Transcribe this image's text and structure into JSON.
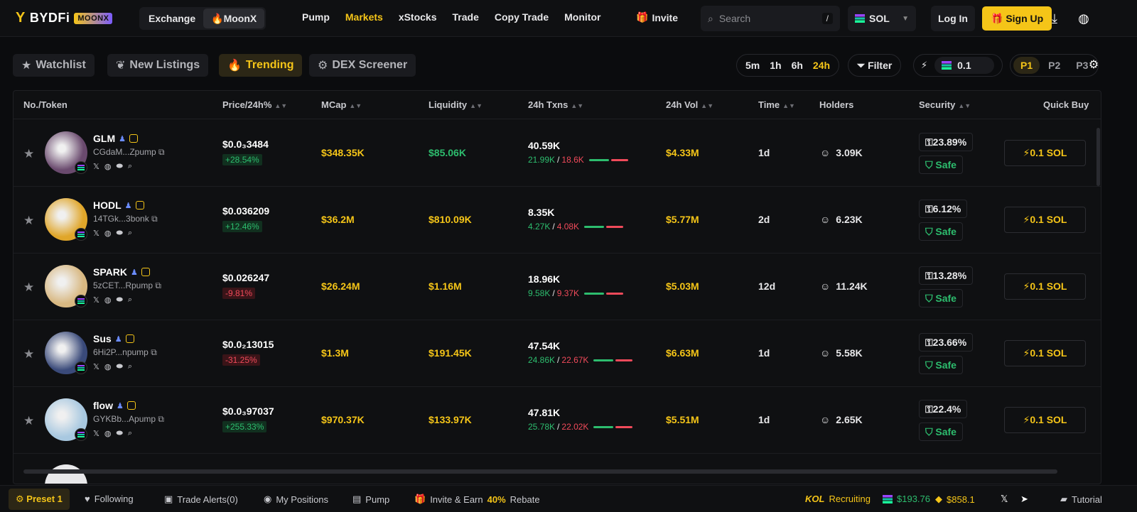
{
  "brand": {
    "name": "BYDFi",
    "badge": "MOONX"
  },
  "header": {
    "segment": [
      "Exchange",
      "MoonX"
    ],
    "links": [
      "Pump",
      "Markets",
      "xStocks",
      "Trade",
      "Copy Trade",
      "Monitor"
    ],
    "active_link": "Markets",
    "invite": "Invite",
    "search_placeholder": "Search",
    "search_shortcut": "/",
    "chain": "SOL",
    "login": "Log In",
    "signup": "Sign Up"
  },
  "tabs": [
    "Watchlist",
    "New Listings",
    "Trending",
    "DEX Screener"
  ],
  "active_tab": "Trending",
  "timeframes": [
    "5m",
    "1h",
    "6h",
    "24h"
  ],
  "active_timeframe": "24h",
  "filter_label": "Filter",
  "quick_amount": "0.1",
  "presets": [
    "P1",
    "P2",
    "P3"
  ],
  "active_preset": "P1",
  "columns": [
    "No./Token",
    "Price/24h%",
    "MCap",
    "Liquidity",
    "24h Txns",
    "24h Vol",
    "Time",
    "Holders",
    "Security",
    "Quick Buy"
  ],
  "rows": [
    {
      "name": "GLM",
      "addr": "CGdaM...Zpump",
      "price": "$0.0₃3484",
      "change": "+28.54%",
      "dir": "up",
      "mcap": "$348.35K",
      "liq": "$85.06K",
      "liq_color": "#2dbd6e",
      "txns": "40.59K",
      "buys": "21.99K",
      "sells": "18.6K",
      "vol": "$4.33M",
      "age": "1d",
      "holders": "3.09K",
      "sec": "23.89%",
      "safe": "Safe",
      "buy": "0.1 SOL",
      "avatar": "#6a4a6e"
    },
    {
      "name": "HODL",
      "addr": "14TGk...3bonk",
      "price": "$0.036209",
      "change": "+12.46%",
      "dir": "up",
      "mcap": "$36.2M",
      "liq": "$810.09K",
      "liq_color": "#f5c518",
      "txns": "8.35K",
      "buys": "4.27K",
      "sells": "4.08K",
      "vol": "$5.77M",
      "age": "2d",
      "holders": "6.23K",
      "sec": "6.12%",
      "safe": "Safe",
      "buy": "0.1 SOL",
      "avatar": "#e0a62a"
    },
    {
      "name": "SPARK",
      "addr": "5zCET...Rpump",
      "price": "$0.026247",
      "change": "-9.81%",
      "dir": "down",
      "mcap": "$26.24M",
      "liq": "$1.16M",
      "liq_color": "#f5c518",
      "txns": "18.96K",
      "buys": "9.58K",
      "sells": "9.37K",
      "vol": "$5.03M",
      "age": "12d",
      "holders": "11.24K",
      "sec": "13.28%",
      "safe": "Safe",
      "buy": "0.1 SOL",
      "avatar": "#d8b882"
    },
    {
      "name": "Sus",
      "addr": "6Hi2P...npump",
      "price": "$0.0₂13015",
      "change": "-31.25%",
      "dir": "down",
      "mcap": "$1.3M",
      "liq": "$191.45K",
      "liq_color": "#f5c518",
      "txns": "47.54K",
      "buys": "24.86K",
      "sells": "22.67K",
      "vol": "$6.63M",
      "age": "1d",
      "holders": "5.58K",
      "sec": "23.66%",
      "safe": "Safe",
      "buy": "0.1 SOL",
      "avatar": "#3a4a7a"
    },
    {
      "name": "flow",
      "addr": "GYKBb...Apump",
      "price": "$0.0₃97037",
      "change": "+255.33%",
      "dir": "up",
      "mcap": "$970.37K",
      "liq": "$133.97K",
      "liq_color": "#f5c518",
      "txns": "47.81K",
      "buys": "25.78K",
      "sells": "22.02K",
      "vol": "$5.51M",
      "age": "1d",
      "holders": "2.65K",
      "sec": "22.4%",
      "safe": "Safe",
      "buy": "0.1 SOL",
      "avatar": "#a8c8e0"
    }
  ],
  "bottom": {
    "preset": "Preset 1",
    "following": "Following",
    "alerts": "Trade Alerts(0)",
    "positions": "My Positions",
    "pump": "Pump",
    "invite": "Invite & Earn",
    "rebate_pct": "40%",
    "rebate": "Rebate",
    "kol": "KOL",
    "recruiting": "Recruiting",
    "sol_price": "$193.76",
    "bnb_price": "$858.1",
    "tutorial": "Tutorial"
  }
}
